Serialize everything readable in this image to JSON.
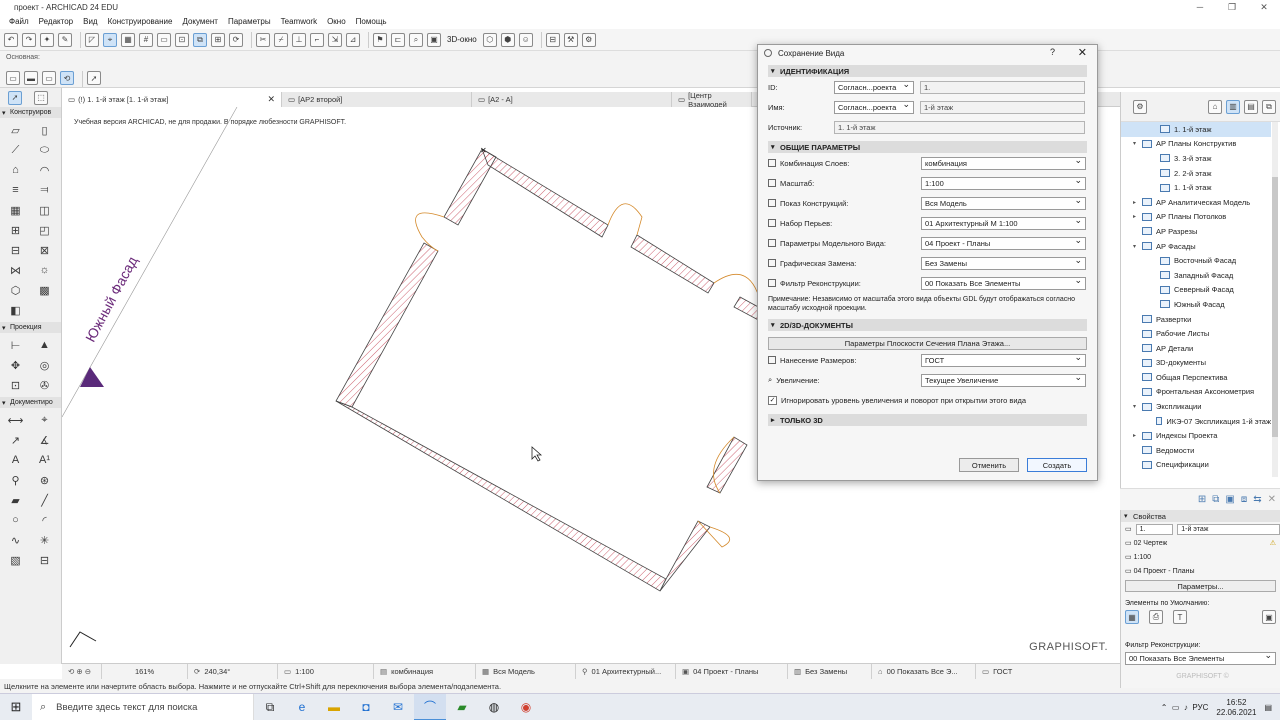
{
  "window": {
    "title": "проект - ARCHICAD 24 EDU"
  },
  "menu": [
    "Файл",
    "Редактор",
    "Вид",
    "Конструирование",
    "Документ",
    "Параметры",
    "Teamwork",
    "Окно",
    "Помощь"
  ],
  "toolbar": {
    "view3d": "3D-окно"
  },
  "infobox": {
    "label": "Основная:"
  },
  "tabs": [
    {
      "label": "(!) 1. 1-й этаж [1. 1-й этаж]",
      "active": true
    },
    {
      "label": "[АР2 второй]"
    },
    {
      "label": "[A2 - A]"
    },
    {
      "label": "[Центр Взаимодей"
    }
  ],
  "toolbox": {
    "sections": [
      "Конструиров",
      "Проекция",
      "Документиро"
    ]
  },
  "canvas": {
    "watermark": "Учебная версия ARCHICAD, не для продажи. В порядке любезности GRAPHISOFT.",
    "facade_label": "Южный Фасад",
    "logo": "GRAPHISOFT."
  },
  "bottom_bar": {
    "zoom": "161%",
    "angle": "240,34°",
    "scale": "1:100",
    "layers": "комбинация",
    "model": "Вся Модель",
    "pens": "01 Архитектурный...",
    "mvo": "04 Проект - Планы",
    "override": "Без Замены",
    "renovation": "00 Показать Все Э...",
    "dimension": "ГОСТ"
  },
  "status": "Щелкните на элементе или начертите область выбора. Нажмите и не отпускайте Ctrl+Shift для переключения выбора элемента/подэлемента.",
  "taskbar": {
    "search_placeholder": "Введите здесь текст для поиска",
    "lang": "РУС",
    "time": "16:52",
    "date": "22.06.2021"
  },
  "navigator": {
    "items": [
      {
        "label": "1. 1-й этаж",
        "level": 2,
        "selected": true
      },
      {
        "label": "АР Планы Конструктив",
        "level": 1,
        "arrow": "▾"
      },
      {
        "label": "3. 3-й этаж",
        "level": 2
      },
      {
        "label": "2. 2-й этаж",
        "level": 2
      },
      {
        "label": "1. 1-й этаж",
        "level": 2
      },
      {
        "label": "АР Аналитическая Модель",
        "level": 1,
        "arrow": "▸"
      },
      {
        "label": "АР Планы Потолков",
        "level": 1,
        "arrow": "▸"
      },
      {
        "label": "АР Разрезы",
        "level": 1
      },
      {
        "label": "АР Фасады",
        "level": 1,
        "arrow": "▾"
      },
      {
        "label": "Восточный Фасад",
        "level": 2
      },
      {
        "label": "Западный Фасад",
        "level": 2
      },
      {
        "label": "Северный Фасад",
        "level": 2
      },
      {
        "label": "Южный Фасад",
        "level": 2
      },
      {
        "label": "Развертки",
        "level": 1
      },
      {
        "label": "Рабочие Листы",
        "level": 1
      },
      {
        "label": "АР Детали",
        "level": 1
      },
      {
        "label": "3D-документы",
        "level": 1
      },
      {
        "label": "Общая Перспектива",
        "level": 1
      },
      {
        "label": "Фронтальная Аксонометрия",
        "level": 1
      },
      {
        "label": "Экспликации",
        "level": 1,
        "arrow": "▾"
      },
      {
        "label": "ИКЭ-07 Экспликация 1-й этаж",
        "level": 2
      },
      {
        "label": "Индексы Проекта",
        "level": 1,
        "arrow": "▸"
      },
      {
        "label": "Ведомости",
        "level": 1
      },
      {
        "label": "Спецификации",
        "level": 1
      }
    ]
  },
  "properties": {
    "header": "Свойства",
    "id_value": "1.",
    "name_value": "1-й этаж",
    "rows": [
      "02 Чертеж",
      "1:100",
      "04 Проект - Планы"
    ],
    "params_button": "Параметры...",
    "defaults_label": "Элементы по Умолчанию:",
    "renovation_label": "Фильтр Реконструкции:",
    "renovation_value": "00 Показать Все Элементы"
  },
  "dialog": {
    "title": "Сохранение Вида",
    "sec_ident": "ИДЕНТИФИКАЦИЯ",
    "id_label": "ID:",
    "id_mode": "Согласн...роекта",
    "id_value": "1.",
    "name_label": "Имя:",
    "name_mode": "Согласн...роекта",
    "name_value": "1-й этаж",
    "source_label": "Источник:",
    "source_value": "1. 1-й этаж",
    "sec_general": "ОБЩИЕ ПАРАМЕТРЫ",
    "rows": [
      {
        "label": "Комбинация Слоев:",
        "value": "комбинация"
      },
      {
        "label": "Масштаб:",
        "value": "1:100"
      },
      {
        "label": "Показ Конструкций:",
        "value": "Вся Модель"
      },
      {
        "label": "Набор Перьев:",
        "value": "01 Архитектурный М 1:100"
      },
      {
        "label": "Параметры Модельного Вида:",
        "value": "04 Проект - Планы"
      },
      {
        "label": "Графическая Замена:",
        "value": "Без Замены"
      },
      {
        "label": "Фильтр Реконструкции:",
        "value": "00 Показать Все Элементы"
      }
    ],
    "note": "Примечание: Независимо от масштаба этого вида объекты GDL будут отображаться согласно масштабу исходной проекции.",
    "sec_docs": "2D/3D-ДОКУМЕНТЫ",
    "cutplane_button": "Параметры Плоскости Сечения Плана Этажа...",
    "dim_label": "Нанесение Размеров:",
    "dim_value": "ГОСТ",
    "zoom_label": "Увеличение:",
    "zoom_value": "Текущее Увеличение",
    "ignore_label": "Игнорировать уровень увеличения и поворот при открытии этого вида",
    "sec_3d": "ТОЛЬКО 3D",
    "cancel": "Отменить",
    "create": "Создать"
  }
}
